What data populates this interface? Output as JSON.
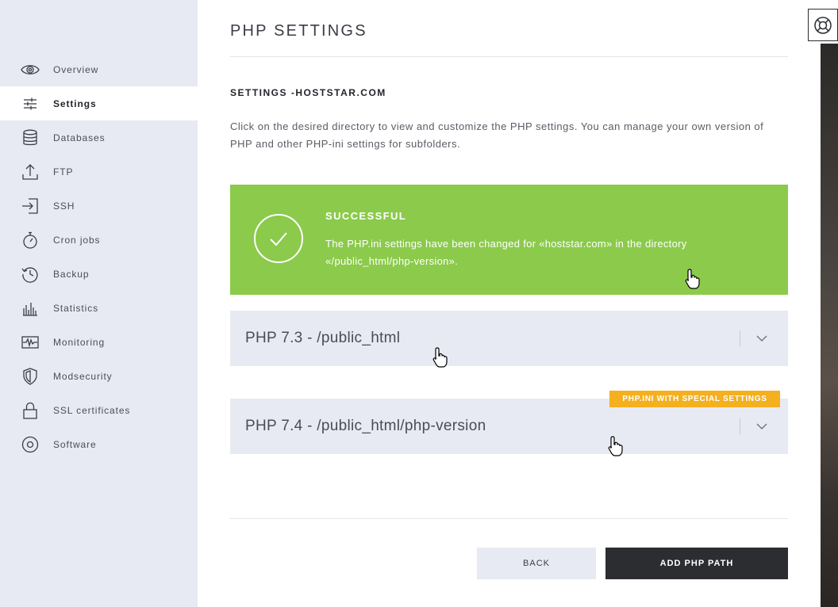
{
  "sidebar": {
    "items": [
      {
        "label": "Overview",
        "icon": "eye-icon"
      },
      {
        "label": "Settings",
        "icon": "sliders-icon",
        "active": true
      },
      {
        "label": "Databases",
        "icon": "database-icon"
      },
      {
        "label": "FTP",
        "icon": "upload-icon"
      },
      {
        "label": "SSH",
        "icon": "login-icon"
      },
      {
        "label": "Cron jobs",
        "icon": "stopwatch-icon"
      },
      {
        "label": "Backup",
        "icon": "history-icon"
      },
      {
        "label": "Statistics",
        "icon": "bar-chart-icon"
      },
      {
        "label": "Monitoring",
        "icon": "pulse-icon"
      },
      {
        "label": "Modsecurity",
        "icon": "shield-icon"
      },
      {
        "label": "SSL certificates",
        "icon": "lock-icon"
      },
      {
        "label": "Software",
        "icon": "disc-icon"
      }
    ]
  },
  "main": {
    "title": "PHP SETTINGS",
    "section_title": "SETTINGS -HOSTSTAR.COM",
    "intro": "Click on the desired directory to view and customize the PHP settings. You can manage your own version of PHP and other PHP-ini settings for subfolders.",
    "alert": {
      "title": "SUCCESSFUL",
      "message": "The PHP.ini settings have been changed for «hoststar.com» in the directory «/public_html/php-version».",
      "color": "#8bca4b"
    },
    "accordions": [
      {
        "label": "PHP 7.3 - /public_html"
      },
      {
        "label": "PHP 7.4 - /public_html/php-version",
        "badge": "PHP.INI WITH SPECIAL SETTINGS"
      }
    ],
    "buttons": {
      "back": "BACK",
      "add": "ADD PHP PATH"
    }
  },
  "colors": {
    "accent_green": "#8bca4b",
    "badge_orange": "#f4b01f",
    "dark": "#2b2d30",
    "sidebar_bg": "#e8eaf3"
  }
}
